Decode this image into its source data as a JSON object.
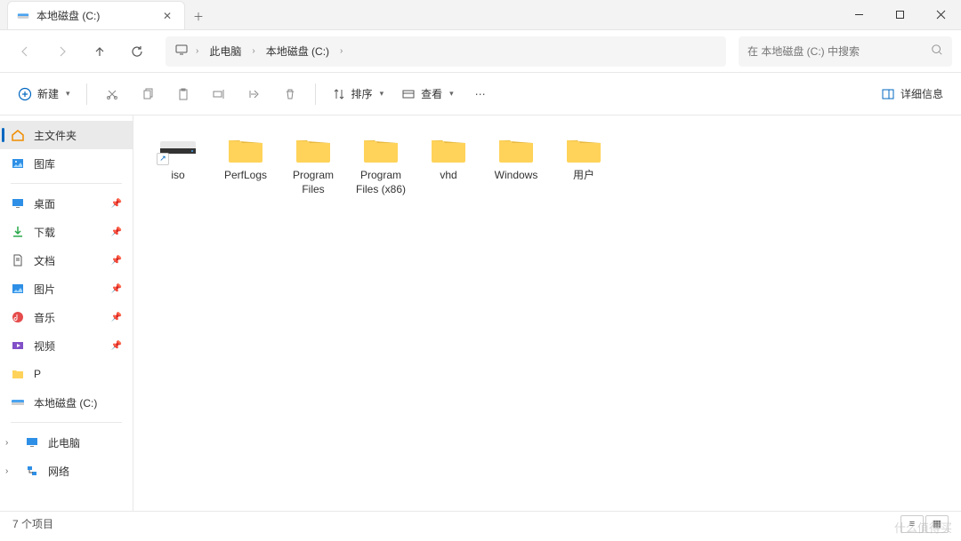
{
  "tab": {
    "title": "本地磁盘 (C:)"
  },
  "nav": {
    "crumb1": "此电脑",
    "crumb2": "本地磁盘 (C:)",
    "search_placeholder": "在 本地磁盘 (C:) 中搜索"
  },
  "toolbar": {
    "new_label": "新建",
    "sort_label": "排序",
    "view_label": "查看",
    "details_label": "详细信息"
  },
  "sidebar": {
    "home": "主文件夹",
    "gallery": "图库",
    "desktop": "桌面",
    "downloads": "下载",
    "documents": "文档",
    "pictures": "图片",
    "music": "音乐",
    "videos": "视频",
    "p_folder": "P",
    "local_disk": "本地磁盘 (C:)",
    "this_pc": "此电脑",
    "network": "网络"
  },
  "files": [
    {
      "name": "iso",
      "type": "drive-shortcut"
    },
    {
      "name": "PerfLogs",
      "type": "folder"
    },
    {
      "name": "Program Files",
      "type": "folder"
    },
    {
      "name": "Program Files (x86)",
      "type": "folder"
    },
    {
      "name": "vhd",
      "type": "folder"
    },
    {
      "name": "Windows",
      "type": "folder"
    },
    {
      "name": "用户",
      "type": "folder"
    }
  ],
  "status": {
    "item_count": "7 个项目"
  },
  "watermark": "什么值得买"
}
